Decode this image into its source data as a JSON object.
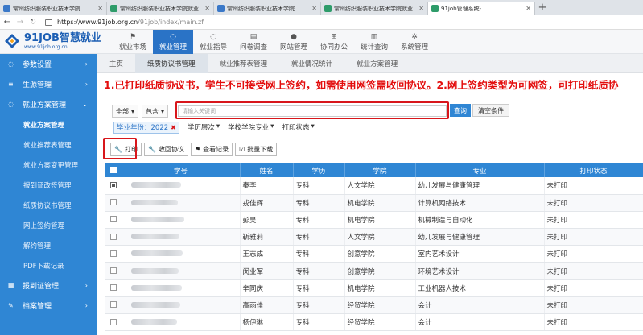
{
  "browser": {
    "tabs": [
      {
        "title": "常州纺织服装职业技术学院",
        "active": false,
        "favicon_color": "#3a78c8"
      },
      {
        "title": "常州纺织服装职业技术学院就业",
        "active": false,
        "favicon_color": "#2e9c6a"
      },
      {
        "title": "常州纺织服装职业技术学院",
        "active": false,
        "favicon_color": "#3a78c8"
      },
      {
        "title": "常州纺织服装职业技术学院就业",
        "active": false,
        "favicon_color": "#2e9c6a"
      },
      {
        "title": "91job管理系统-",
        "active": true,
        "favicon_color": "#2e9c6a"
      }
    ],
    "url_host": "https://www.91job.org.cn",
    "url_path": "/91job/index/main.zf"
  },
  "header": {
    "logo_main": "91JOB智慧就业",
    "logo_sub": "www.91job.org.cn",
    "nav": [
      {
        "label": "就业市场",
        "icon": "flag-icon",
        "glyph": "⚑",
        "active": false
      },
      {
        "label": "就业管理",
        "icon": "chat-icon",
        "glyph": "◌",
        "active": true
      },
      {
        "label": "就业指导",
        "icon": "chat-icon",
        "glyph": "◌",
        "active": false
      },
      {
        "label": "问卷调查",
        "icon": "document-icon",
        "glyph": "▤",
        "active": false
      },
      {
        "label": "网站管理",
        "icon": "apple-icon",
        "glyph": "●",
        "active": false
      },
      {
        "label": "协同办公",
        "icon": "windows-icon",
        "glyph": "⊞",
        "active": false
      },
      {
        "label": "统计查询",
        "icon": "bar-chart-icon",
        "glyph": "▥",
        "active": false
      },
      {
        "label": "系统管理",
        "icon": "gears-icon",
        "glyph": "✲",
        "active": false
      }
    ]
  },
  "sidebar": {
    "groups_top": [
      {
        "label": "参数设置",
        "icon": "chat-icon",
        "glyph": "◌"
      },
      {
        "label": "生源管理",
        "icon": "list-icon",
        "glyph": "≡"
      },
      {
        "label": "就业方案管理",
        "icon": "chat-icon",
        "glyph": "◌"
      }
    ],
    "subitems": [
      {
        "label": "就业方案管理",
        "active": true
      },
      {
        "label": "就业推荐表管理",
        "active": false
      },
      {
        "label": "就业方案变更管理",
        "active": false
      },
      {
        "label": "报到证改签管理",
        "active": false
      },
      {
        "label": "纸质协议书管理",
        "active": false
      },
      {
        "label": "网上签约管理",
        "active": false
      },
      {
        "label": "解约管理",
        "active": false
      },
      {
        "label": "PDF下载记录",
        "active": false
      }
    ],
    "groups_bottom": [
      {
        "label": "报到证管理",
        "icon": "grid-icon",
        "glyph": "▦"
      },
      {
        "label": "档案管理",
        "icon": "edit-icon",
        "glyph": "✎"
      }
    ]
  },
  "content_tabs": [
    {
      "label": "主页",
      "active": false
    },
    {
      "label": "纸质协议书管理",
      "active": true
    },
    {
      "label": "就业推荐表管理",
      "active": false
    },
    {
      "label": "就业情况统计",
      "active": false
    },
    {
      "label": "就业方案管理",
      "active": false
    }
  ],
  "notice": "1.已打印纸质协议书，学生不可接受网上签约，如需使用网签需收回协议。2.网上签约类型为可网签，可打印纸质协",
  "search": {
    "scope": "全部",
    "match": "包含",
    "placeholder": "请输入关键词",
    "search_label": "查询",
    "clear_label": "清空条件"
  },
  "filters": {
    "year_chip": "毕业年份：2022",
    "options": [
      "学历层次",
      "学校学院专业",
      "打印状态"
    ]
  },
  "actions": [
    {
      "label": "打印",
      "icon": "wrench-icon",
      "glyph": "🔧"
    },
    {
      "label": "收回协议",
      "icon": "wrench-icon",
      "glyph": "🔧"
    },
    {
      "label": "查看记录",
      "icon": "flag-icon",
      "glyph": "⚑"
    },
    {
      "label": "批量下载",
      "icon": "checkbox-icon",
      "glyph": "☑"
    }
  ],
  "table": {
    "columns": [
      "学号",
      "姓名",
      "学历",
      "学院",
      "专业",
      "打印状态"
    ],
    "rows": [
      {
        "checked": true,
        "name": "秦李",
        "degree": "专科",
        "college": "人文学院",
        "major": "幼儿发展与健康管理",
        "status": "未打印"
      },
      {
        "checked": false,
        "name": "戎佳辉",
        "degree": "专科",
        "college": "机电学院",
        "major": "计算机网络技术",
        "status": "未打印"
      },
      {
        "checked": false,
        "name": "彭昊",
        "degree": "专科",
        "college": "机电学院",
        "major": "机械制造与自动化",
        "status": "未打印"
      },
      {
        "checked": false,
        "name": "靳雅莉",
        "degree": "专科",
        "college": "人文学院",
        "major": "幼儿发展与健康管理",
        "status": "未打印"
      },
      {
        "checked": false,
        "name": "王志成",
        "degree": "专科",
        "college": "创意学院",
        "major": "室内艺术设计",
        "status": "未打印"
      },
      {
        "checked": false,
        "name": "闵业军",
        "degree": "专科",
        "college": "创意学院",
        "major": "环境艺术设计",
        "status": "未打印"
      },
      {
        "checked": false,
        "name": "辛同庆",
        "degree": "专科",
        "college": "机电学院",
        "major": "工业机器人技术",
        "status": "未打印"
      },
      {
        "checked": false,
        "name": "高雨佳",
        "degree": "专科",
        "college": "经贸学院",
        "major": "会计",
        "status": "未打印"
      },
      {
        "checked": false,
        "name": "杨伊琳",
        "degree": "专科",
        "college": "经贸学院",
        "major": "会计",
        "status": "未打印"
      }
    ]
  },
  "colors": {
    "primary": "#2f86d4",
    "highlight": "#d8161b",
    "notice": "#e30d0d"
  }
}
